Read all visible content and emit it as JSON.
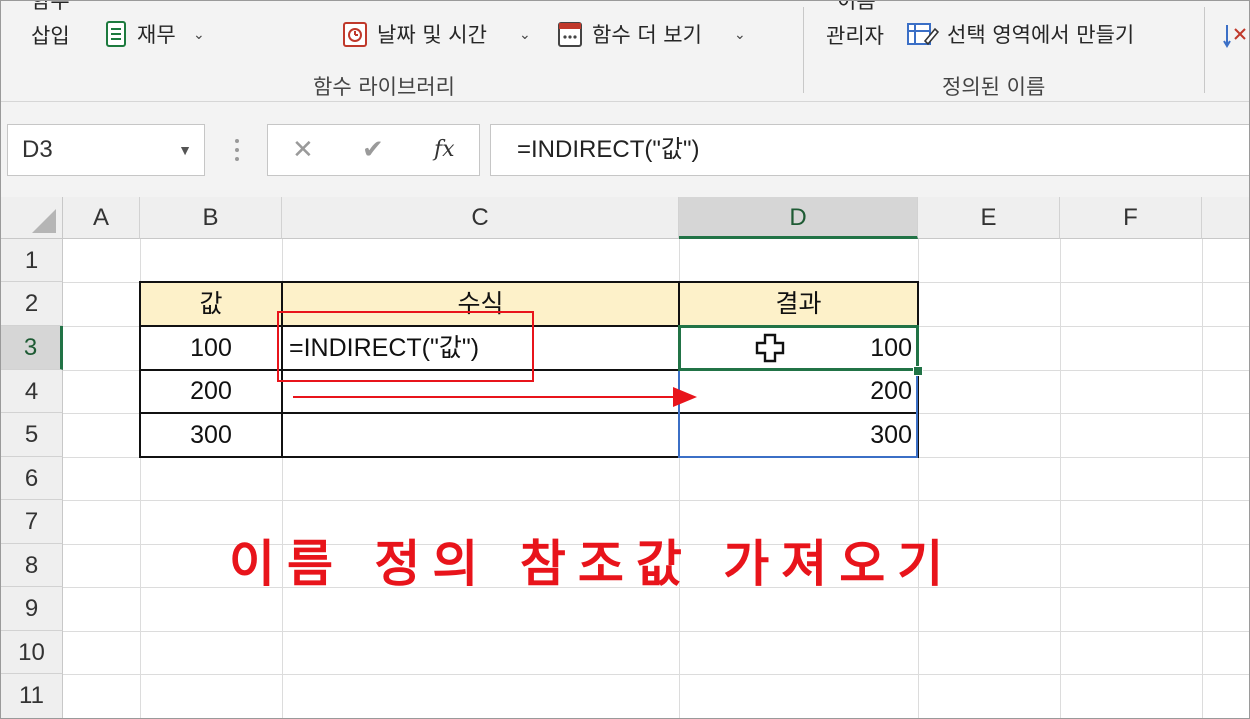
{
  "ribbon": {
    "insert_function_top": "함수",
    "insert_function_bottom": "삽입",
    "financial": "재무",
    "date_time": "날짜 및 시간",
    "more_functions": "함수 더 보기",
    "name_top": "이름",
    "name_manager_bottom": "관리자",
    "create_from_selection": "선택 영역에서 만들기",
    "group_function_library": "함수 라이브러리",
    "group_defined_names": "정의된 이름"
  },
  "formula_bar": {
    "name_box": "D3",
    "cancel_glyph": "✕",
    "enter_glyph": "✔",
    "fx_glyph": "fx",
    "formula": "=INDIRECT(\"값\")"
  },
  "columns": [
    "A",
    "B",
    "C",
    "D",
    "E",
    "F"
  ],
  "rows": [
    "1",
    "2",
    "3",
    "4",
    "5",
    "6",
    "7",
    "8",
    "9",
    "10",
    "11"
  ],
  "table": {
    "header_value": "값",
    "header_formula": "수식",
    "header_result": "결과",
    "values": [
      "100",
      "200",
      "300"
    ],
    "formula_text": "=INDIRECT(\"값\")",
    "results": [
      "100",
      "200",
      "300"
    ]
  },
  "annotation": {
    "caption": "이름 정의 참조값 가져오기",
    "accent_color": "#e8141b"
  },
  "colors": {
    "header_fill": "#fdf1c9",
    "selection_green": "#217346",
    "range_blue": "#3b6fc6"
  }
}
